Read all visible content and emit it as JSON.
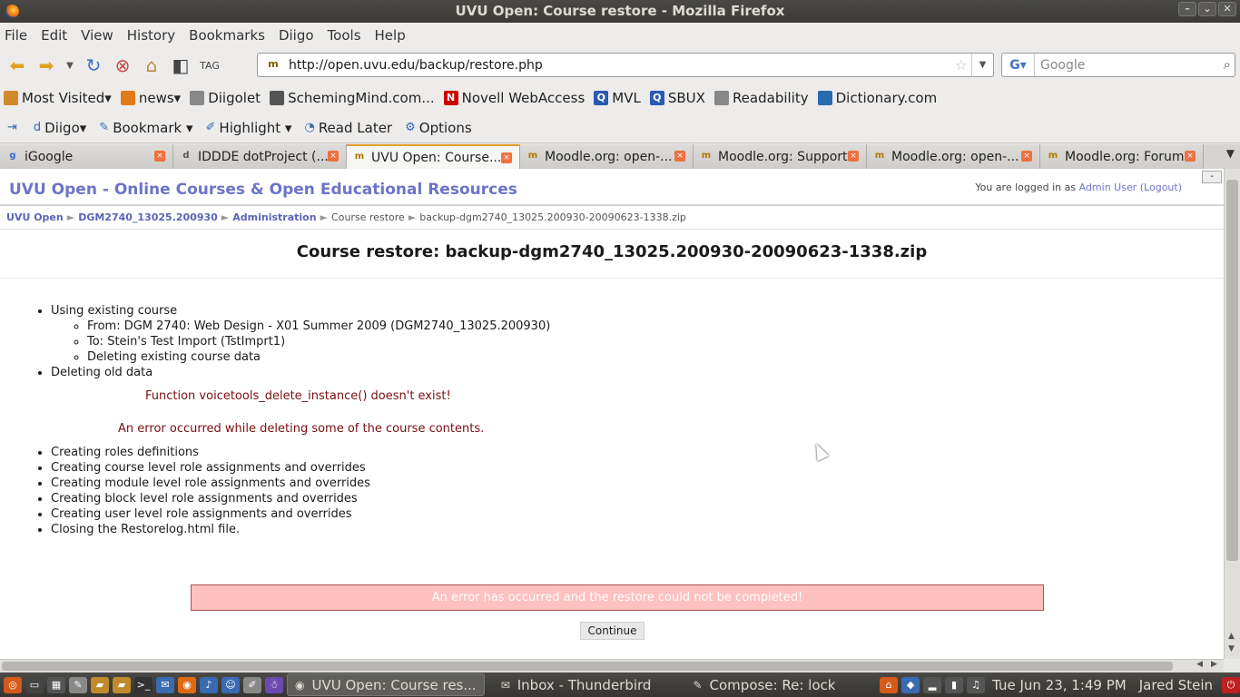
{
  "window": {
    "title": "UVU Open: Course restore - Mozilla Firefox"
  },
  "menu": [
    "File",
    "Edit",
    "View",
    "History",
    "Bookmarks",
    "Diigo",
    "Tools",
    "Help"
  ],
  "nav": {
    "url": "http://open.uvu.edu/backup/restore.php",
    "search_placeholder": "Google"
  },
  "bookmarks": [
    {
      "label": "Most Visited",
      "icon": "folder-icon",
      "color": "#d08a2a"
    },
    {
      "label": "news",
      "icon": "rss-icon",
      "color": "#e07b1a"
    },
    {
      "label": "Diigolet",
      "icon": "diigolet-icon",
      "color": "#888"
    },
    {
      "label": "SchemingMind.com...",
      "icon": "knight-icon",
      "color": "#555"
    },
    {
      "label": "Novell WebAccess",
      "icon": "novell-icon",
      "color": "#c00"
    },
    {
      "label": "MVL",
      "icon": "mvl-icon",
      "color": "#2a5ab0"
    },
    {
      "label": "SBUX",
      "icon": "sbux-icon",
      "color": "#2a5ab0"
    },
    {
      "label": "Readability",
      "icon": "readability-icon",
      "color": "#888"
    },
    {
      "label": "Dictionary.com",
      "icon": "dictionary-icon",
      "color": "#2a6ab0"
    }
  ],
  "diigo": {
    "diigo": "Diigo",
    "bookmark": "Bookmark",
    "highlight": "Highlight",
    "read_later": "Read Later",
    "options": "Options"
  },
  "tabs": [
    {
      "label": "iGoogle",
      "fav": "g"
    },
    {
      "label": "IDDDE dotProject (...",
      "fav": "d"
    },
    {
      "label": "UVU Open: Course...",
      "fav": "m",
      "active": true
    },
    {
      "label": "Moodle.org: open-...",
      "fav": "m"
    },
    {
      "label": "Moodle.org: Support",
      "fav": "m"
    },
    {
      "label": "Moodle.org: open-...",
      "fav": "m"
    },
    {
      "label": "Moodle.org: Forums",
      "fav": "m"
    }
  ],
  "page": {
    "site_name": "UVU Open - Online Courses & Open Educational Resources",
    "login_prefix": "You are logged in as",
    "login_user": "Admin User",
    "logout": "(Logout)",
    "collapse": "-",
    "breadcrumbs": [
      "UVU Open",
      "DGM2740_13025.200930",
      "Administration",
      "Course restore",
      "backup-dgm2740_13025.200930-20090623-1338.zip"
    ],
    "title": "Course restore: backup-dgm2740_13025.200930-20090623-1338.zip",
    "step_existing": "Using existing course",
    "sub_steps": [
      "From: DGM 2740: Web Design - X01 Summer 2009 (DGM2740_13025.200930)",
      "To: Stein's Test Import (TstImprt1)",
      "Deleting existing course data"
    ],
    "step_deleting": "Deleting old data",
    "error_function": "Function voicetools_delete_instance() doesn't exist!",
    "error_contents": "An error occurred while deleting some of the course contents.",
    "steps_after": [
      "Creating roles definitions",
      "Creating course level role assignments and overrides",
      "Creating module level role assignments and overrides",
      "Creating block level role assignments and overrides",
      "Creating user level role assignments and overrides",
      "Closing the Restorelog.html file."
    ],
    "error_banner": "An error has occurred and the restore could not be completed!",
    "continue": "Continue"
  },
  "taskbar": {
    "tasks": [
      {
        "label": "UVU Open: Course res...",
        "icon": "firefox-icon",
        "active": true
      },
      {
        "label": "Inbox - Thunderbird",
        "icon": "thunderbird-icon"
      },
      {
        "label": "Compose: Re: lock",
        "icon": "compose-icon"
      }
    ],
    "clock": "Tue Jun 23,  1:49 PM",
    "user": "Jared Stein"
  }
}
